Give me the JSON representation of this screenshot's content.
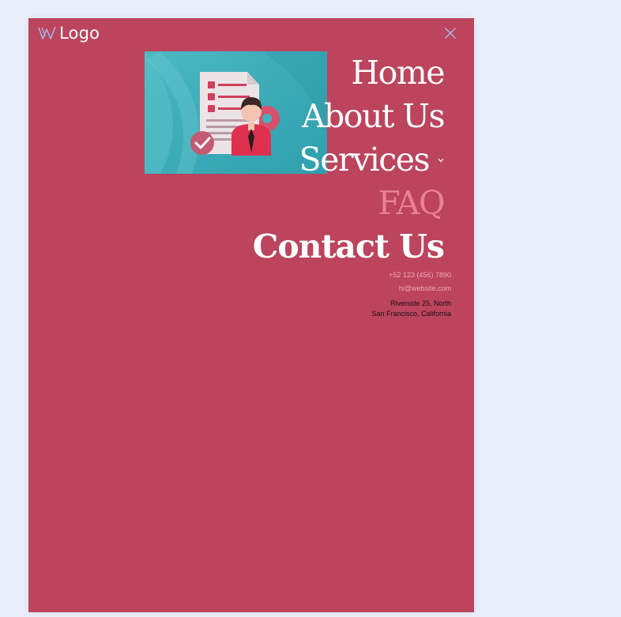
{
  "logo": {
    "text": "Logo",
    "icon": "w-logo-icon"
  },
  "close": {
    "icon": "close-icon",
    "color": "#aab8ec"
  },
  "menu_image": {
    "alt": "checklist-document-with-person-illustration"
  },
  "nav": {
    "items": [
      {
        "label": "Home",
        "active": false
      },
      {
        "label": "About Us",
        "active": false
      },
      {
        "label": "Services",
        "active": false,
        "has_dropdown": true
      },
      {
        "label": "FAQ",
        "active": true
      },
      {
        "label": "Contact Us",
        "active": false
      }
    ]
  },
  "contact": {
    "phone": "+52 123 (456) 7890",
    "email": "hi@website.com",
    "address_line1": "Riverside 25, North",
    "address_line2": "San Francisco, California"
  },
  "colors": {
    "page_background": "#e9eff8",
    "panel": "#bc445d",
    "active_link": "#ea7f96",
    "link": "#ffffff",
    "muted_text": "#f0a7b6"
  }
}
